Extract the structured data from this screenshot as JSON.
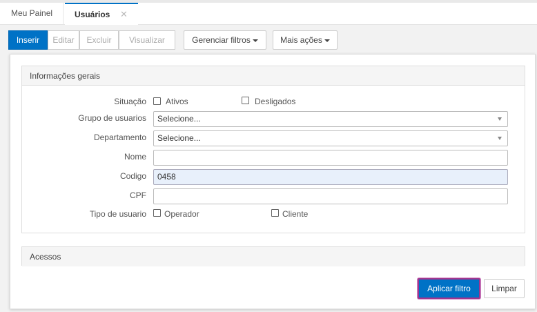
{
  "tabs": [
    {
      "label": "Meu Painel"
    },
    {
      "label": "Usuários",
      "close": "✕"
    }
  ],
  "toolbar": {
    "insert": "Inserir",
    "edit": "Editar",
    "delete": "Excluir",
    "view": "Visualizar",
    "filters": "Gerenciar filtros",
    "more": "Mais ações"
  },
  "general": {
    "title": "Informações gerais",
    "situacao": {
      "label": "Situação",
      "opt1": "Ativos",
      "opt2": "Desligados"
    },
    "grupo": {
      "label": "Grupo de usuarios",
      "value": "Selecione..."
    },
    "departamento": {
      "label": "Departamento",
      "value": "Selecione..."
    },
    "nome": {
      "label": "Nome",
      "value": ""
    },
    "codigo": {
      "label": "Codigo",
      "value": "0458"
    },
    "cpf": {
      "label": "CPF",
      "value": ""
    },
    "tipo": {
      "label": "Tipo de usuario",
      "opt1": "Operador",
      "opt2": "Cliente"
    }
  },
  "access": {
    "title": "Acessos"
  },
  "actions": {
    "apply": "Aplicar filtro",
    "clear": "Limpar"
  },
  "colors": {
    "accent": "#0072c6",
    "focus_ring": "#a0358e"
  }
}
